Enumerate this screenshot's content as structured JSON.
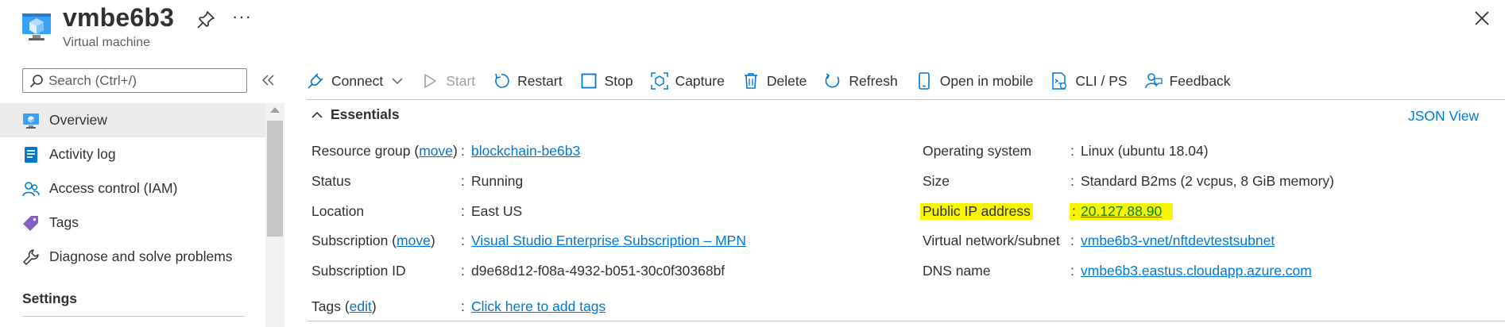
{
  "header": {
    "title": "vmbe6b3",
    "subtitle": "Virtual machine",
    "more_label": "···"
  },
  "sidebar": {
    "search_placeholder": "Search (Ctrl+/)",
    "items": [
      {
        "label": "Overview",
        "icon": "monitor-icon",
        "active": true
      },
      {
        "label": "Activity log",
        "icon": "activity-log-icon"
      },
      {
        "label": "Access control (IAM)",
        "icon": "people-icon"
      },
      {
        "label": "Tags",
        "icon": "tag-icon"
      },
      {
        "label": "Diagnose and solve problems",
        "icon": "wrench-icon"
      }
    ],
    "section_label": "Settings"
  },
  "toolbar": {
    "connect": "Connect",
    "start": "Start",
    "restart": "Restart",
    "stop": "Stop",
    "capture": "Capture",
    "delete": "Delete",
    "refresh": "Refresh",
    "open_mobile": "Open in mobile",
    "cli_ps": "CLI / PS",
    "feedback": "Feedback"
  },
  "essentials": {
    "title": "Essentials",
    "json_view": "JSON View",
    "left": {
      "resource_group_label": "Resource group",
      "resource_group_move": "move",
      "resource_group_value": "blockchain-be6b3",
      "status_label": "Status",
      "status_value": "Running",
      "location_label": "Location",
      "location_value": "East US",
      "subscription_label": "Subscription",
      "subscription_move": "move",
      "subscription_value": "Visual Studio Enterprise Subscription – MPN",
      "subscription_id_label": "Subscription ID",
      "subscription_id_value": "d9e68d12-f08a-4932-b051-30c0f30368bf",
      "tags_label": "Tags",
      "tags_edit": "edit",
      "tags_value": "Click here to add tags"
    },
    "right": {
      "os_label": "Operating system",
      "os_value": "Linux (ubuntu 18.04)",
      "size_label": "Size",
      "size_value": "Standard B2ms (2 vcpus, 8 GiB memory)",
      "public_ip_label": "Public IP address",
      "public_ip_value": "20.127.88.90",
      "vnet_label": "Virtual network/subnet",
      "vnet_value": "vmbe6b3-vnet/nftdevtestsubnet",
      "dns_label": "DNS name",
      "dns_value": "vmbe6b3.eastus.cloudapp.azure.com"
    }
  },
  "colors": {
    "accent": "#0078d4",
    "highlight": "#f5f500",
    "active_nav": "#ebebeb"
  }
}
